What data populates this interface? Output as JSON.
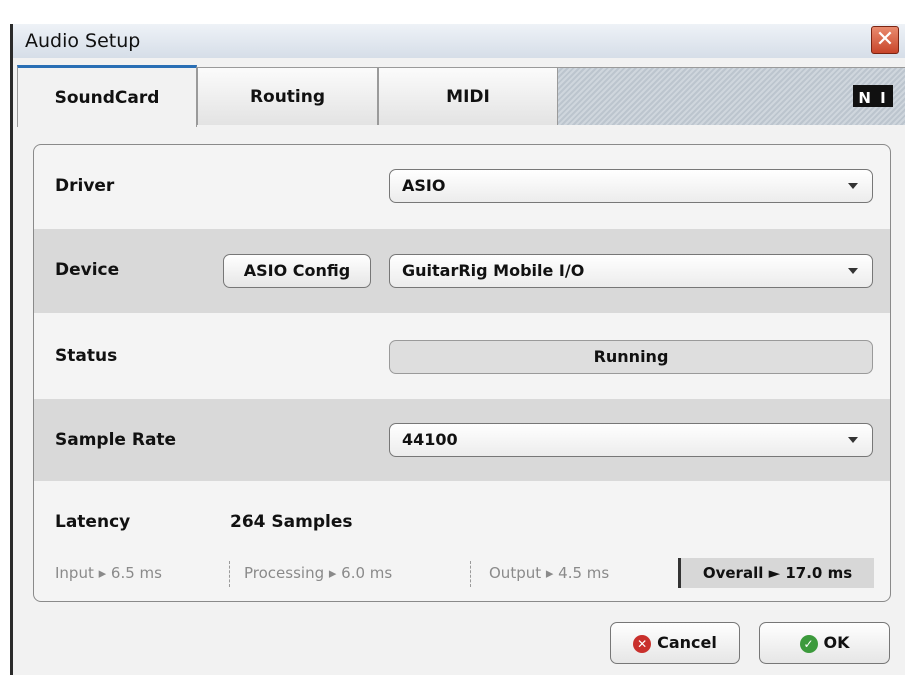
{
  "window": {
    "title": "Audio Setup",
    "close_glyph": "✕"
  },
  "tabs": [
    {
      "label": "SoundCard",
      "active": true
    },
    {
      "label": "Routing",
      "active": false
    },
    {
      "label": "MIDI",
      "active": false
    }
  ],
  "logo": {
    "text": "N I",
    "icon": "native-instruments-logo"
  },
  "soundcard": {
    "driver": {
      "label": "Driver",
      "value": "ASIO"
    },
    "device": {
      "label": "Device",
      "config_button": "ASIO Config",
      "value": "GuitarRig Mobile I/O"
    },
    "status": {
      "label": "Status",
      "value": "Running"
    },
    "sample_rate": {
      "label": "Sample Rate",
      "value": "44100"
    },
    "latency": {
      "label": "Latency",
      "value": "264 Samples",
      "input": "Input ▸ 6.5 ms",
      "processing": "Processing ▸ 6.0 ms",
      "output": "Output ▸ 4.5 ms",
      "overall": "Overall ► 17.0 ms"
    }
  },
  "buttons": {
    "cancel": "Cancel",
    "ok": "OK"
  },
  "colors": {
    "tab_accent": "#2a6fb5",
    "close_red": "#c8452a",
    "cancel_icon": "#c9302c",
    "ok_icon": "#3c9a3c"
  }
}
